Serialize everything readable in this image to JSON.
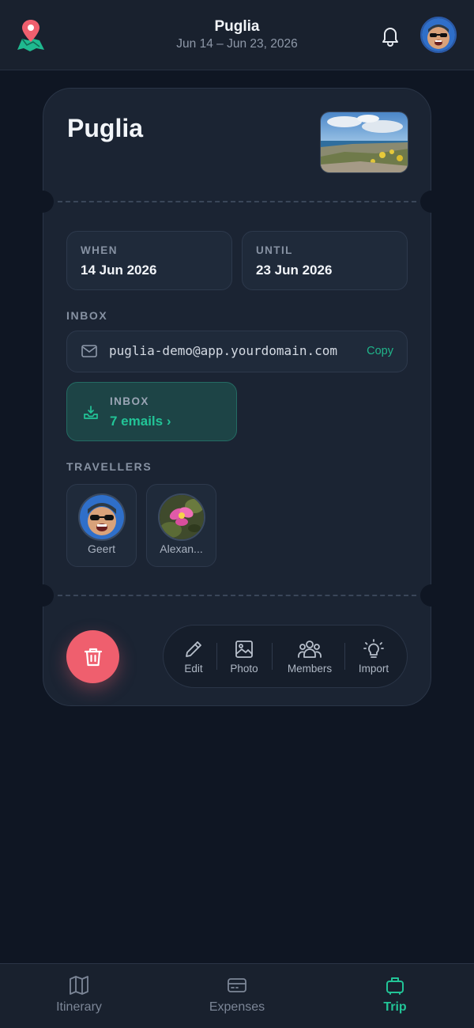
{
  "header": {
    "title": "Puglia",
    "dates": "Jun 14 – Jun 23, 2026"
  },
  "card": {
    "title": "Puglia",
    "when": {
      "label": "WHEN",
      "value": "14 Jun 2026"
    },
    "until": {
      "label": "UNTIL",
      "value": "23 Jun 2026"
    },
    "inbox_section_label": "INBOX",
    "email": "puglia-demo@app.yourdomain.com",
    "copy_label": "Copy",
    "inbox": {
      "label": "INBOX",
      "count": "7 emails ›"
    },
    "travellers_label": "TRAVELLERS",
    "travellers": [
      {
        "name": "Geert"
      },
      {
        "name": "Alexan..."
      }
    ]
  },
  "toolbar": {
    "edit": "Edit",
    "photo": "Photo",
    "members": "Members",
    "import": "Import"
  },
  "nav": {
    "itinerary": "Itinerary",
    "expenses": "Expenses",
    "trip": "Trip"
  },
  "colors": {
    "accent": "#22c497",
    "danger": "#ef5f6e",
    "background": "#0f1623",
    "card": "#1b2433"
  },
  "icons": [
    "map-pin-logo-icon",
    "bell-icon",
    "mail-icon",
    "inbox-download-icon",
    "trash-icon",
    "pencil-icon",
    "image-icon",
    "users-icon",
    "lightbulb-icon",
    "map-icon",
    "credit-card-icon",
    "suitcase-icon"
  ]
}
